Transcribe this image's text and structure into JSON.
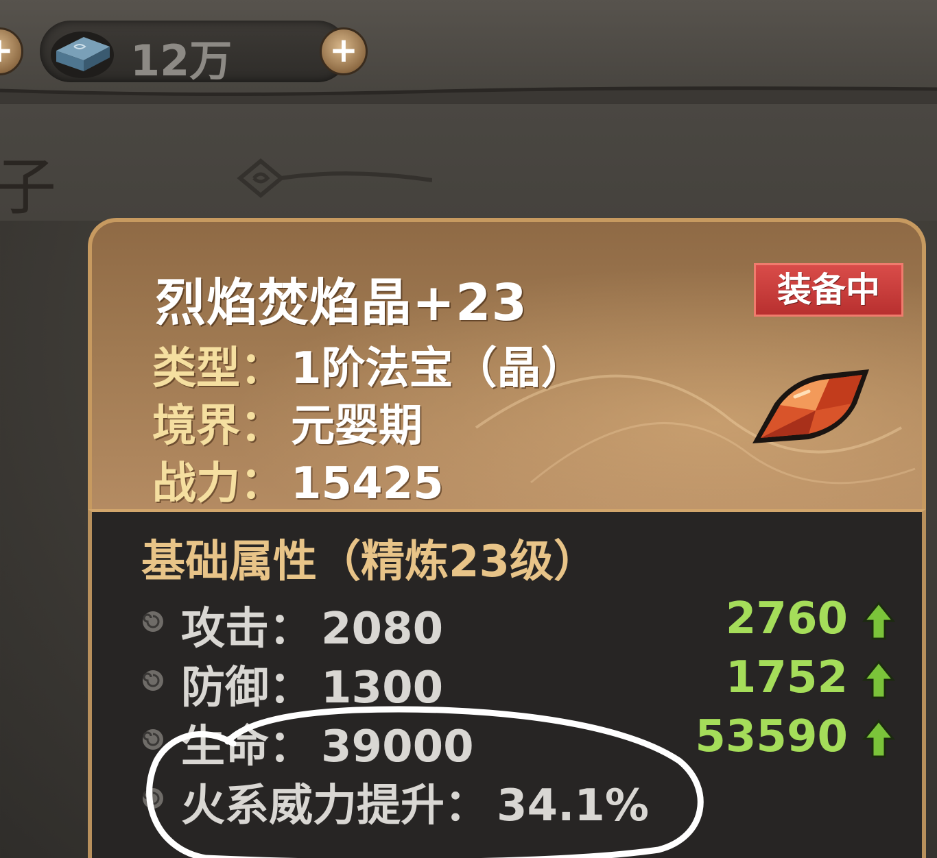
{
  "currency": {
    "amount": "12万",
    "icon": "ink-stone-icon"
  },
  "background": {
    "title": "子"
  },
  "item": {
    "name": "烈焰焚焰晶+23",
    "status_badge": "装备中",
    "icon": "fire-crystal-icon",
    "info": [
      {
        "label": "类型：",
        "value": "1阶法宝（晶）"
      },
      {
        "label": "境界：",
        "value": "元婴期"
      },
      {
        "label": "战力：",
        "value": "15425"
      }
    ]
  },
  "attributes": {
    "title": "基础属性（精炼23级）",
    "stats": [
      {
        "label": "攻击：",
        "value": "2080",
        "upgrade": "2760"
      },
      {
        "label": "防御：",
        "value": "1300",
        "upgrade": "1752"
      },
      {
        "label": "生命：",
        "value": "39000",
        "upgrade": "53590"
      },
      {
        "label": "火系威力提升：",
        "value": "34.1%"
      }
    ]
  },
  "colors": {
    "upgrade_text": "#a5dd5a",
    "badge_red": "#c93b39",
    "label_gold": "#f5dfa0",
    "section_gold": "#e8c488",
    "panel_bronze": "#a07a52"
  }
}
